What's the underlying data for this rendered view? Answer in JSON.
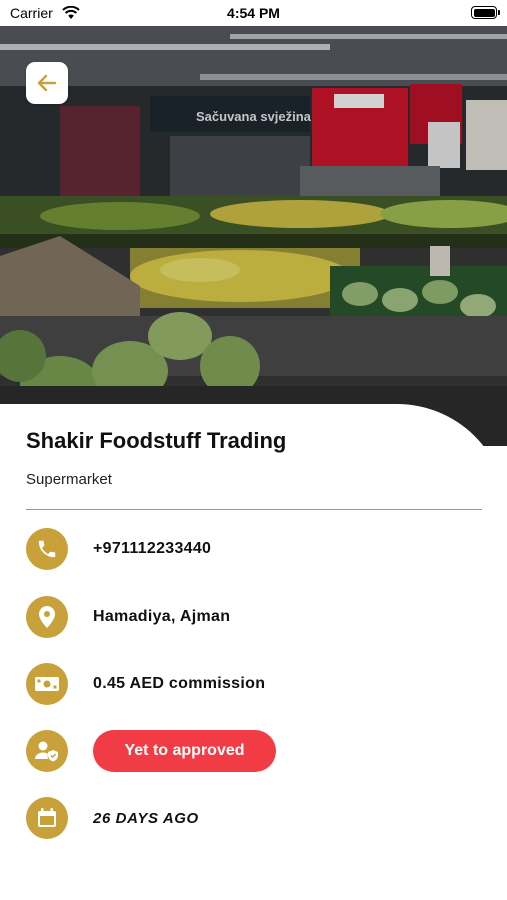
{
  "status_bar": {
    "carrier": "Carrier",
    "time": "4:54 PM"
  },
  "hero": {
    "store_sign": "Sačuvana svježina"
  },
  "store": {
    "name": "Shakir Foodstuff Trading",
    "category": "Supermarket"
  },
  "details": {
    "phone": "+971112233440",
    "location": "Hamadiya, Ajman",
    "commission": "0.45 AED commission",
    "status": "Yet to approved",
    "date": "26 DAYS AGO"
  },
  "colors": {
    "accent": "#c9a13a",
    "status_red": "#f23c45",
    "back_arrow": "#c9a13a"
  },
  "icons": [
    "back-arrow-icon",
    "phone-icon",
    "location-pin-icon",
    "cash-icon",
    "user-shield-icon",
    "calendar-icon"
  ]
}
